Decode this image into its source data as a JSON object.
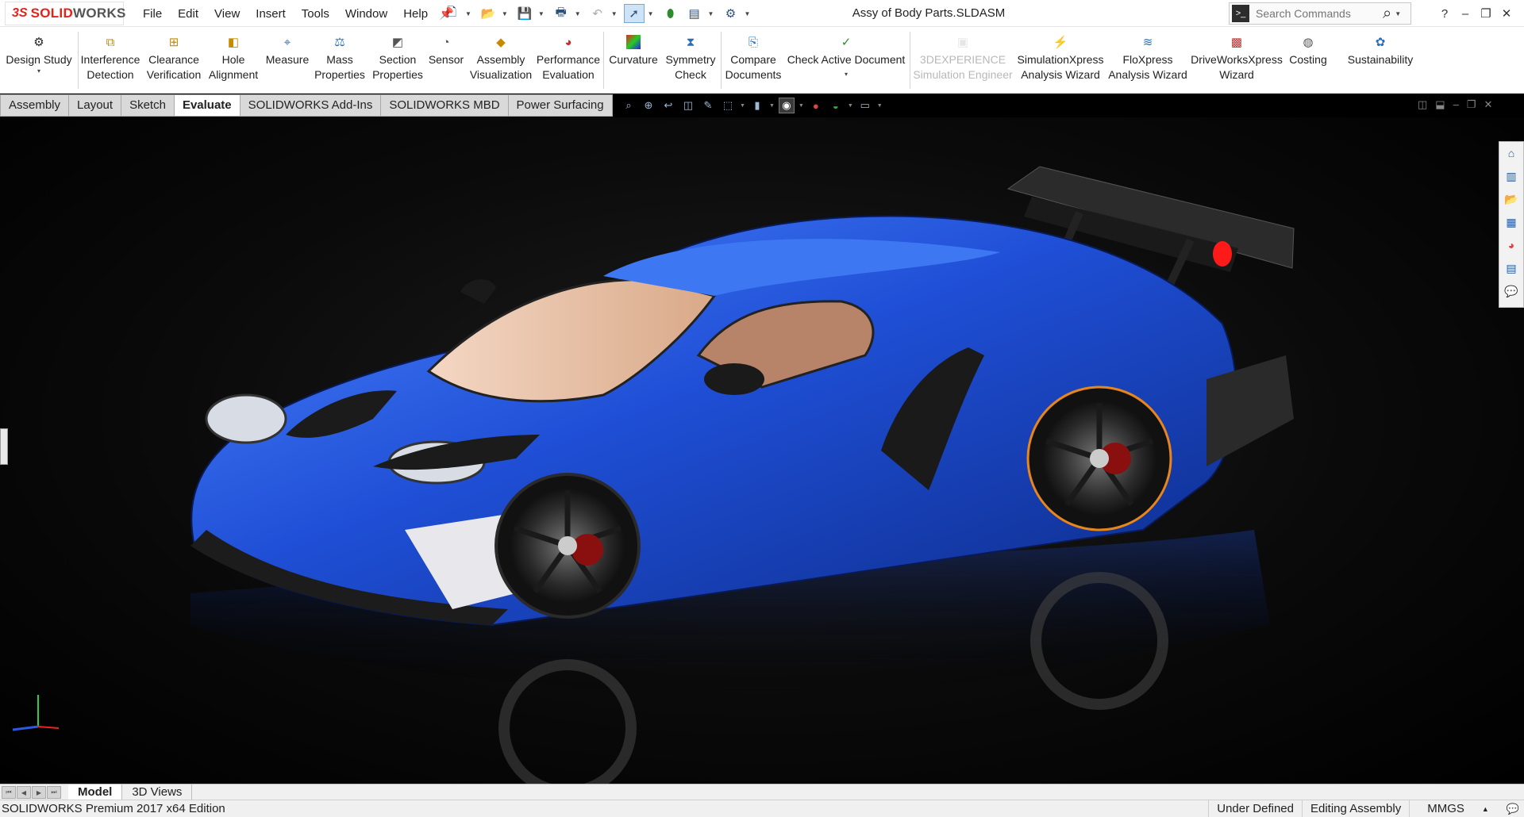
{
  "titlebar": {
    "logo_ds": "3S",
    "logo_brand_solid": "SOLID",
    "logo_brand_works": "WORKS",
    "menus": [
      "File",
      "Edit",
      "View",
      "Insert",
      "Tools",
      "Window",
      "Help"
    ],
    "document_title": "Assy of Body Parts.SLDASM",
    "search_placeholder": "Search Commands",
    "window_controls": [
      "?",
      "–",
      "❐",
      "✕"
    ]
  },
  "ribbon": {
    "design_study": "Design Study",
    "interference_1": "Interference",
    "interference_2": "Detection",
    "clearance_1": "Clearance",
    "clearance_2": "Verification",
    "hole_1": "Hole",
    "hole_2": "Alignment",
    "measure": "Measure",
    "mass_1": "Mass",
    "mass_2": "Properties",
    "section_1": "Section",
    "section_2": "Properties",
    "sensor": "Sensor",
    "asmviz_1": "Assembly",
    "asmviz_2": "Visualization",
    "perf_1": "Performance",
    "perf_2": "Evaluation",
    "curvature": "Curvature",
    "symmetry_1": "Symmetry",
    "symmetry_2": "Check",
    "compare_1": "Compare",
    "compare_2": "Documents",
    "check_active": "Check Active Document",
    "exp_1": "3DEXPERIENCE",
    "exp_2": "Simulation Engineer",
    "simx_1": "SimulationXpress",
    "simx_2": "Analysis Wizard",
    "flox_1": "FloXpress",
    "flox_2": "Analysis Wizard",
    "dwx_1": "DriveWorksXpress",
    "dwx_2": "Wizard",
    "costing": "Costing",
    "sustainability": "Sustainability"
  },
  "tabs": [
    {
      "label": "Assembly"
    },
    {
      "label": "Layout"
    },
    {
      "label": "Sketch"
    },
    {
      "label": "Evaluate",
      "active": true
    },
    {
      "label": "SOLIDWORKS Add-Ins"
    },
    {
      "label": "SOLIDWORKS MBD"
    },
    {
      "label": "Power Surfacing"
    }
  ],
  "bottom_tabs": [
    {
      "label": "Model",
      "active": true
    },
    {
      "label": "3D Views"
    }
  ],
  "status": {
    "edition": "SOLIDWORKS Premium 2017 x64 Edition",
    "definition": "Under Defined",
    "mode": "Editing Assembly",
    "units": "MMGS",
    "units_caret": "▲"
  },
  "colors": {
    "brand_red": "#e2231a",
    "car_body": "#1f4fd6",
    "brake_light": "#ff1a1a",
    "tire_stripe": "#e8861a",
    "active_tab_bg": "#ffffff"
  },
  "icons": {
    "design_study": "design-study-icon",
    "search": "magnifier-icon",
    "home": "home-icon"
  }
}
